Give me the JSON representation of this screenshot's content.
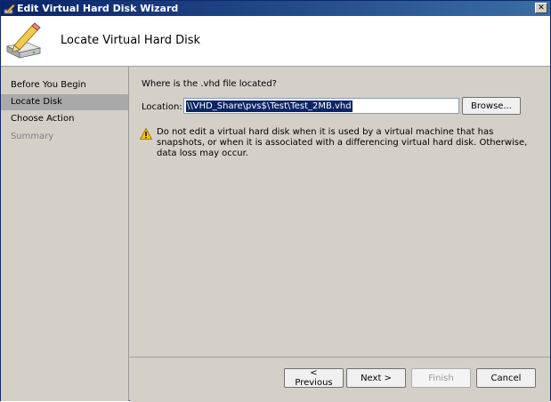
{
  "window": {
    "title": "Edit Virtual Hard Disk Wizard",
    "close_glyph": "✕"
  },
  "header": {
    "heading": "Locate Virtual Hard Disk"
  },
  "nav": {
    "items": [
      {
        "label": "Before You Begin",
        "state": "normal"
      },
      {
        "label": "Locate Disk",
        "state": "active"
      },
      {
        "label": "Choose Action",
        "state": "normal"
      },
      {
        "label": "Summary",
        "state": "disabled"
      }
    ]
  },
  "main": {
    "question": "Where is the .vhd file located?",
    "location_label": "Location:",
    "location_value": "\\\\VHD_Share\\pvs$\\Test\\Test_2MB.vhd",
    "browse_label": "Browse...",
    "warning": "Do not edit a virtual hard disk when it is used by a virtual machine that has snapshots, or when it is associated with a differencing virtual hard disk. Otherwise, data loss may occur."
  },
  "footer": {
    "previous_label": "< Previous",
    "next_label": "Next >",
    "finish_label": "Finish",
    "cancel_label": "Cancel"
  },
  "icons": {
    "app": "wizard-pencil-icon",
    "header": "hard-disk-pencil-icon",
    "warning": "warning-icon",
    "close": "close-icon"
  }
}
